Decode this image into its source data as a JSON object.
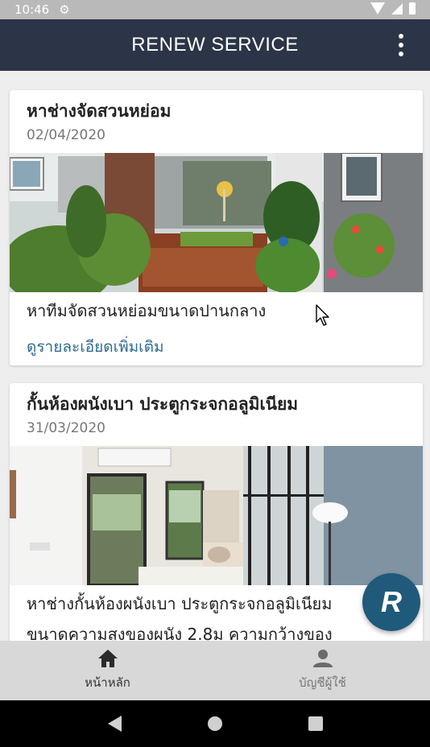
{
  "status_bar": {
    "time": "10:46"
  },
  "app_bar": {
    "title": "RENEW SERVICE"
  },
  "posts": [
    {
      "title": "หาช่างจัดสวนหย่อม",
      "date": "02/04/2020",
      "description": "หาทีมจัดสวนหย่อมขนาดปานกลาง",
      "link": "ดูรายละเอียดเพิ่มเติม"
    },
    {
      "title": "กั้นห้องผนังเบา ประตูกระจกอลูมิเนียม",
      "date": "31/03/2020",
      "description_lines": [
        "หาช่างกั้นห้องผนังเบา ประตูกระจกอลูมิเนียม",
        "ขนาดความสูงของผนัง 2.8ม ความกว้างของ"
      ]
    }
  ],
  "fab": {
    "letter": "R"
  },
  "bottom_nav": [
    {
      "label": "หน้าหลัก",
      "icon": "home-icon"
    },
    {
      "label": "บัญชีผู้ใช้",
      "icon": "person-icon"
    }
  ],
  "colors": {
    "app_bar": "#2c3447",
    "link": "#2f6b8f",
    "fab": "#1f5a7a"
  }
}
